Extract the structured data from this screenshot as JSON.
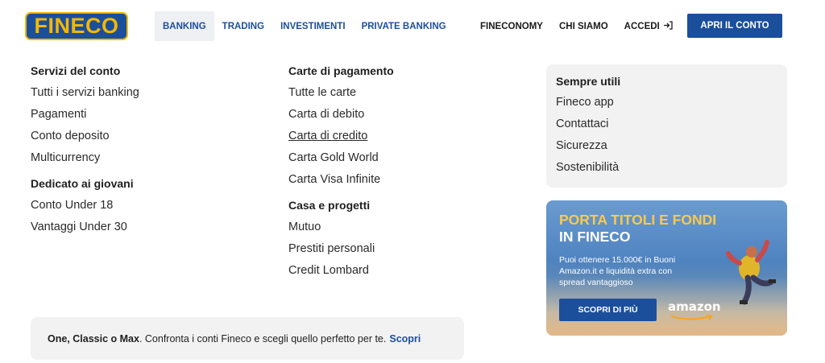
{
  "header": {
    "logo_text": "FINECO",
    "nav_left": [
      "BANKING",
      "TRADING",
      "INVESTIMENTI",
      "PRIVATE BANKING"
    ],
    "nav_right": {
      "fineconomy": "FINECONOMY",
      "chi_siamo": "CHI SIAMO",
      "accedi": "ACCEDI",
      "accedi_icon": "login-arrow-icon"
    },
    "open_account": "APRI IL CONTO",
    "active_tab": "BANKING"
  },
  "menu": {
    "col1": [
      {
        "title": "Servizi del conto",
        "items": [
          "Tutti i servizi banking",
          "Pagamenti",
          "Conto deposito",
          "Multicurrency"
        ]
      },
      {
        "title": "Dedicato ai giovani",
        "items": [
          "Conto Under 18",
          "Vantaggi Under 30"
        ]
      }
    ],
    "col2": [
      {
        "title": "Carte di pagamento",
        "items": [
          "Tutte le carte",
          "Carta di debito",
          "Carta di credito",
          "Carta Gold World",
          "Carta Visa Infinite"
        ]
      },
      {
        "title": "Casa e progetti",
        "items": [
          "Mutuo",
          "Prestiti personali",
          "Credit Lombard"
        ]
      }
    ],
    "useful": {
      "title": "Sempre utili",
      "items": [
        "Fineco app",
        "Contattaci",
        "Sicurezza",
        "Sostenibilità"
      ]
    }
  },
  "promo": {
    "title_line1": "PORTA TITOLI E FONDI",
    "title_line2": "IN FINECO",
    "text": "Puoi ottenere 15.000€ in Buoni Amazon.it e liquidità extra con spread vantaggioso",
    "button": "SCOPRI DI PIÙ",
    "brand": "amazon"
  },
  "compare": {
    "bold": "One, Classic o Max",
    "text": ". Confronta i conti Fineco e scegli quello perfetto per te.",
    "link": "Scopri"
  },
  "colors": {
    "brand_blue": "#1b4f9c",
    "brand_yellow": "#f5b700",
    "panel_gray": "#f2f2f3"
  }
}
